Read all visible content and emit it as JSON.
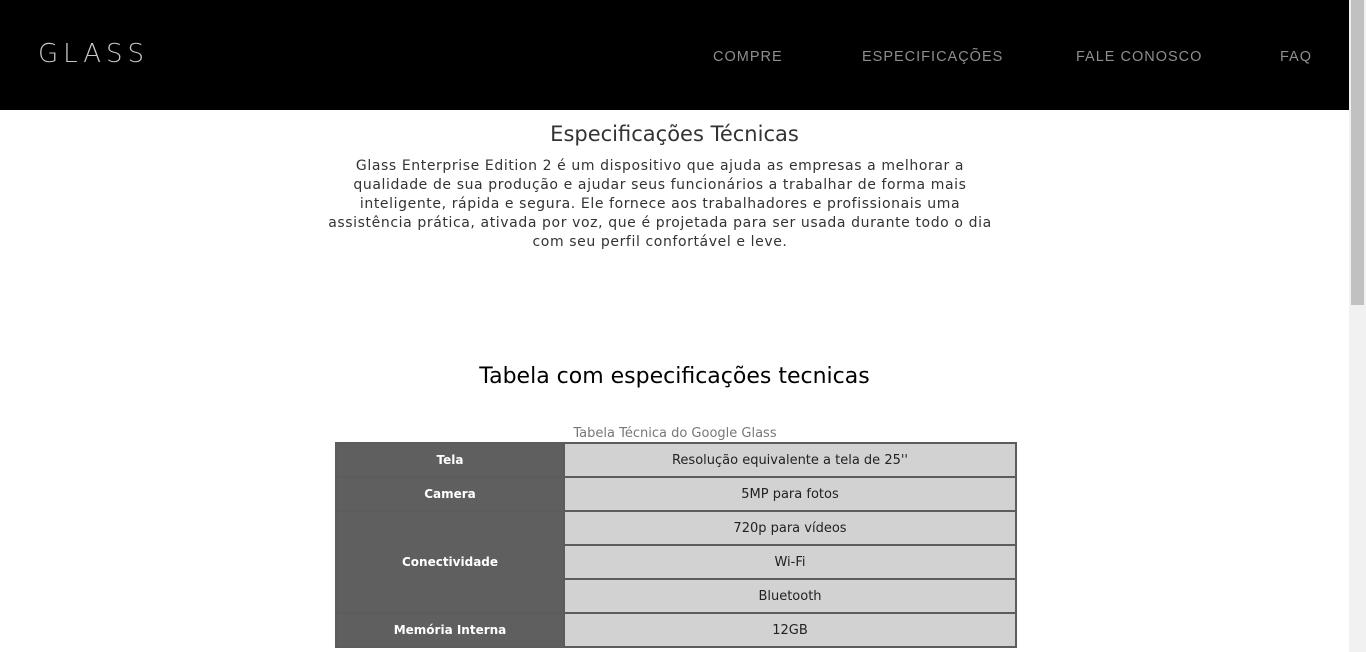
{
  "header": {
    "logo": "GLASS",
    "nav": [
      "COMPRE",
      "ESPECIFICAÇÕES",
      "FALE CONOSCO",
      "FAQ"
    ]
  },
  "main": {
    "title": "Especificações Técnicas",
    "description": "Glass Enterprise Edition 2 é um dispositivo que ajuda as empresas a melhorar a qualidade de sua produção e ajudar seus funcionários a trabalhar de forma mais inteligente, rápida e segura. Ele fornece aos trabalhadores e profissionais uma assistência prática, ativada por voz, que é projetada para ser usada durante todo o dia com seu perfil confortável e leve.",
    "table_heading": "Tabela com especificações tecnicas",
    "table": {
      "caption": "Tabela Técnica do Google Glass",
      "rows": [
        {
          "label": "Tela",
          "values": [
            "Resolução equivalente a tela de 25''"
          ]
        },
        {
          "label": "Camera",
          "values": [
            "5MP para fotos"
          ]
        },
        {
          "label": "Conectividade",
          "values": [
            "720p para vídeos",
            "Wi-Fi",
            "Bluetooth"
          ]
        },
        {
          "label": "Memória Interna",
          "values": [
            "12GB"
          ]
        }
      ]
    }
  },
  "colors": {
    "header_bg": "#000000",
    "label_cell_bg": "#5f5f5f",
    "value_cell_bg": "#d2d2d2"
  }
}
